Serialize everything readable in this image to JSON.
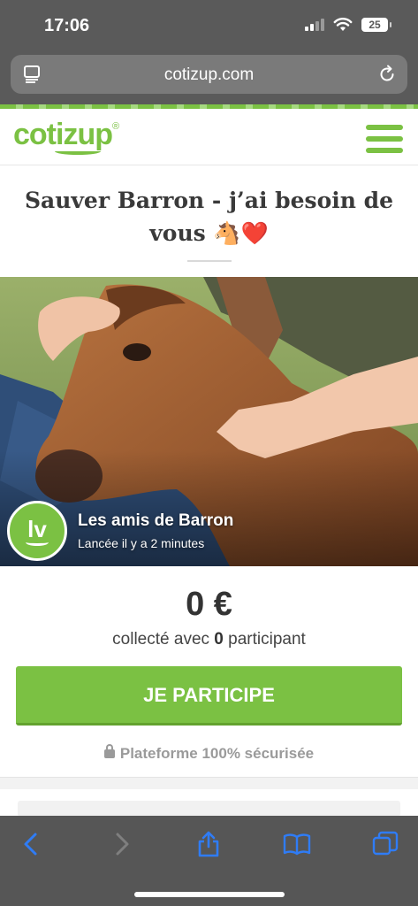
{
  "status_bar": {
    "time": "17:06",
    "battery": "25"
  },
  "browser": {
    "url": "cotizup.com"
  },
  "site": {
    "logo": "cotizup",
    "logo_mark": "®"
  },
  "campaign": {
    "title": "Sauver Barron - j’ai besoin de vous 🐴❤️",
    "organizer_initials": "lv",
    "organizer_name": "Les amis de Barron",
    "launched": "Lancée il y a 2 minutes",
    "amount": "0 €",
    "collected_prefix": "collecté avec ",
    "participants": "0",
    "collected_suffix": " participant",
    "cta_label": "JE PARTICIPE",
    "secure_label": "Plateforme 100% sécurisée"
  },
  "colors": {
    "brand_green": "#7bc143",
    "chrome_gray": "#5a5a5a",
    "toolbar_blue": "#2f7cf6"
  },
  "toolbar_icons": [
    "back-icon",
    "forward-icon",
    "share-icon",
    "bookmarks-icon",
    "tabs-icon"
  ]
}
